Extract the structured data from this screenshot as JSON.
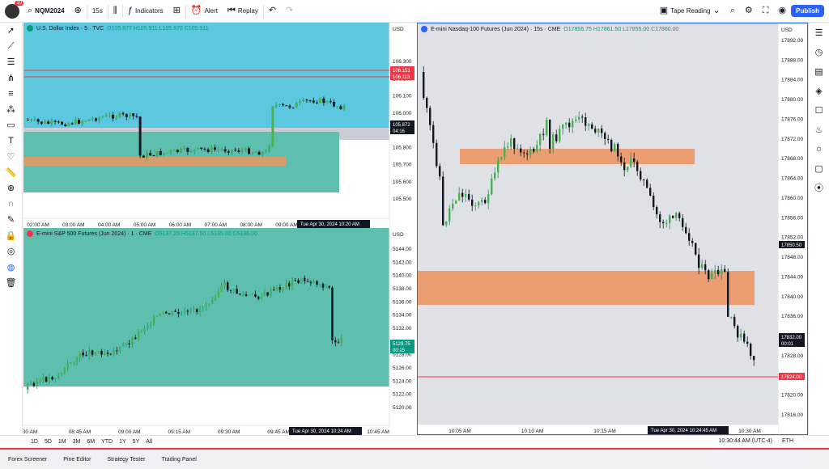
{
  "header": {
    "avatar_badge": "10",
    "symbol": "NQM2024",
    "interval": "15s",
    "indicators": "Indicators",
    "alert": "Alert",
    "replay": "Replay",
    "layout_name": "Tape Reading",
    "publish": "Publish"
  },
  "bottom": {
    "ranges": [
      "1D",
      "5D",
      "1M",
      "3M",
      "6M",
      "YTD",
      "1Y",
      "5Y",
      "All"
    ],
    "clock": "10:30:44 AM (UTC-4)",
    "session": "ETH"
  },
  "footer": {
    "tabs": [
      "Forex Screener",
      "Pine Editor",
      "Strategy Tester",
      "Trading Panel"
    ]
  },
  "currency": "USD",
  "panes": {
    "dxy": {
      "legend": "U.S. Dollar Index · 5 · TVC",
      "ohlc": "O105.877  H105.911  L105.870  C105.911",
      "ticks": [
        "106.300",
        "106.200",
        "106.100",
        "106.000",
        "105.900",
        "105.800",
        "105.700",
        "105.600",
        "105.500"
      ],
      "times": [
        "02:00 AM",
        "03:00 AM",
        "04:00 AM",
        "05:00 AM",
        "06:00 AM",
        "07:00 AM",
        "08:00 AM",
        "09:00 AM"
      ],
      "crosshair_time": "Tue Apr 30, 2024",
      "crosshair_time2": "10:20 AM",
      "tags": [
        {
          "text": "106.151",
          "color": "#f23645"
        },
        {
          "text": "106.113",
          "color": "#f23645"
        },
        {
          "text": "105.872",
          "color": "#131722"
        },
        {
          "text": "04:16",
          "color": "#131722"
        }
      ]
    },
    "es": {
      "legend": "E-mini S&P 500 Futures (Jun 2024) · 1 · CME",
      "ohlc": "O5137.25  H5137.50  L5135.00  C5136.00",
      "ticks": [
        "5144.00",
        "5142.00",
        "5140.00",
        "5138.00",
        "5136.00",
        "5134.00",
        "5132.00",
        "5130.00",
        "5128.00",
        "5126.00",
        "5124.00",
        "5122.00",
        "5120.00"
      ],
      "times": [
        "30 AM",
        "08:45 AM",
        "09:00 AM",
        "09:15 AM",
        "09:30 AM",
        "09:45 AM",
        "10:00 AM",
        "10:45 AM"
      ],
      "crosshair_time": "Tue Apr 30, 2024",
      "crosshair_time2": "10:24 AM",
      "tags": [
        {
          "text": "5129.75",
          "color": "#089981"
        },
        {
          "text": "00:15",
          "color": "#089981"
        }
      ]
    },
    "nq": {
      "legend": "E-mini Nasdaq-100 Futures (Jun 2024) · 15s · CME",
      "ohlc": "O17856.75  H17861.50  L17855.00  C17860.00",
      "ticks": [
        "17892.00",
        "17888.00",
        "17884.00",
        "17880.00",
        "17876.00",
        "17872.00",
        "17868.00",
        "17864.00",
        "17860.00",
        "17856.00",
        "17852.00",
        "17848.00",
        "17844.00",
        "17840.00",
        "17836.00",
        "17832.00",
        "17828.00",
        "17824.00",
        "17820.00",
        "17816.00"
      ],
      "times": [
        "10:05 AM",
        "10:10 AM",
        "10:15 AM",
        "10:20 AM",
        "10:30 AM"
      ],
      "crosshair_time": "Tue Apr 30, 2024",
      "crosshair_time2": "10:24:45 AM",
      "tags": [
        {
          "text": "17850.50",
          "color": "#131722"
        },
        {
          "text": "17832.00",
          "color": "#131722"
        },
        {
          "text": "00:01",
          "color": "#131722"
        },
        {
          "text": "17824.00",
          "color": "#f23645"
        }
      ]
    }
  }
}
